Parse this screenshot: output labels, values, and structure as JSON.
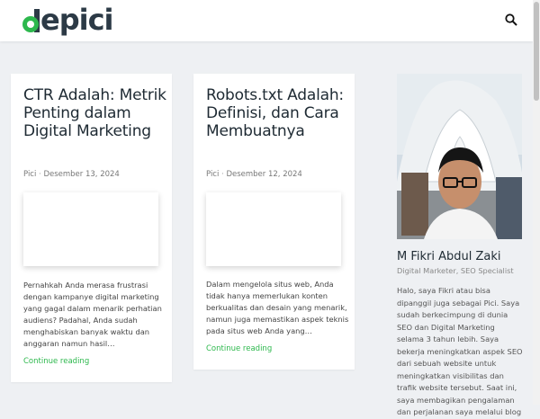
{
  "brand": {
    "logo_text": "epici",
    "logo_color": "#2db84d",
    "accent_color": "#2db84d"
  },
  "header": {
    "search_icon": "search-icon"
  },
  "posts": [
    {
      "title": "CTR Adalah: Metrik Penting dalam Digital Marketing",
      "author": "Pici",
      "date": "Desember 13, 2024",
      "excerpt": "Pernahkah Anda merasa frustrasi dengan kampanye digital marketing yang gagal dalam menarik perhatian audiens? Padahal, Anda sudah menghabiskan banyak waktu dan anggaran namun hasil…",
      "read_more": "Continue reading"
    },
    {
      "title": "Robots.txt Adalah: Definisi, dan Cara Membuatnya",
      "author": "Pici",
      "date": "Desember 12, 2024",
      "excerpt": "Dalam mengelola situs web, Anda tidak hanya memerlukan konten berkualitas dan desain yang menarik, namun juga memastikan aspek teknis pada situs web Anda yang…",
      "read_more": "Continue reading"
    }
  ],
  "meta_separator": "·",
  "profile": {
    "name": "M Fikri Abdul Zaki",
    "role": "Digital Marketer, SEO Specialist",
    "bio": "Halo, saya Fikri atau bisa dipanggil juga sebagai Pici. Saya sudah berkecimpung di dunia SEO dan Digital Marketing selama 3 tahun lebih. Saya bekerja meningkatkan aspek SEO dari sebuah website untuk meningkatkan visibilitas dan trafik website tersebut. Saat ini, saya membagikan pengalaman dan perjalanan saya melalui blog"
  }
}
